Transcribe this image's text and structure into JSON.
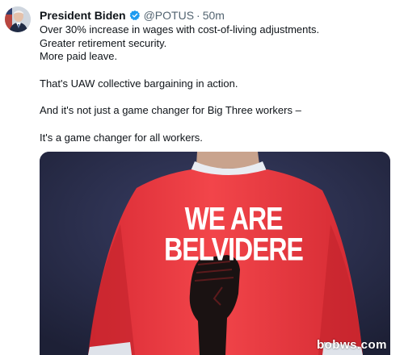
{
  "author": {
    "name": "President Biden",
    "handle": "@POTUS",
    "separator": "·",
    "time": "50m"
  },
  "tweet": {
    "lines": [
      "Over 30% increase in wages with cost-of-living adjustments.",
      "Greater retirement security.",
      "More paid leave.",
      "That's UAW collective bargaining in action.",
      "And it's not just a game changer for Big Three workers –",
      "It's a game changer for all workers."
    ]
  },
  "media": {
    "shirt_line1": "WE ARE",
    "shirt_line2": "BELVIDERE",
    "watermark": "bobws.com"
  },
  "colors": {
    "verified": "#1d9bf0",
    "shirt_red": "#f0393f",
    "background": "#2b2f4d"
  },
  "icons": {
    "verified": "verified-badge-icon",
    "fist": "raised-fist-icon"
  }
}
